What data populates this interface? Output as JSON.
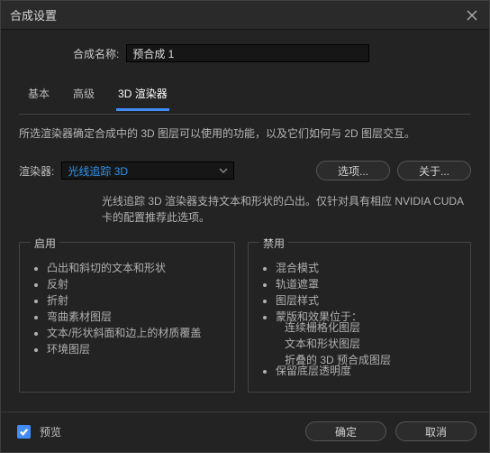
{
  "titlebar": {
    "title": "合成设置"
  },
  "name_row": {
    "label": "合成名称:",
    "value": "预合成 1"
  },
  "tabs": [
    {
      "label": "基本"
    },
    {
      "label": "高级"
    },
    {
      "label": "3D 渲染器"
    }
  ],
  "description": "所选渲染器确定合成中的 3D 图层可以使用的功能，以及它们如何与 2D 图层交互。",
  "renderer_row": {
    "label": "渲染器:",
    "selected": "光线追踪 3D",
    "options_btn": "选项...",
    "about_btn": "关于..."
  },
  "renderer_desc": "光线追踪 3D 渲染器支持文本和形状的凸出。仅针对具有相应 NVIDIA CUDA 卡的配置推荐此选项。",
  "enable": {
    "legend": "启用",
    "items": [
      "凸出和斜切的文本和形状",
      "反射",
      "折射",
      "弯曲素材图层",
      "文本/形状斜面和边上的材质覆盖",
      "环境图层"
    ]
  },
  "disable": {
    "legend": "禁用",
    "items": [
      "混合模式",
      "轨道遮罩",
      "图层样式",
      "蒙版和效果位于："
    ],
    "subitems": [
      "连续栅格化图层",
      "文本和形状图层",
      "折叠的 3D 预合成图层"
    ],
    "last": "保留底层透明度"
  },
  "footer": {
    "preview": "预览",
    "ok": "确定",
    "cancel": "取消"
  }
}
